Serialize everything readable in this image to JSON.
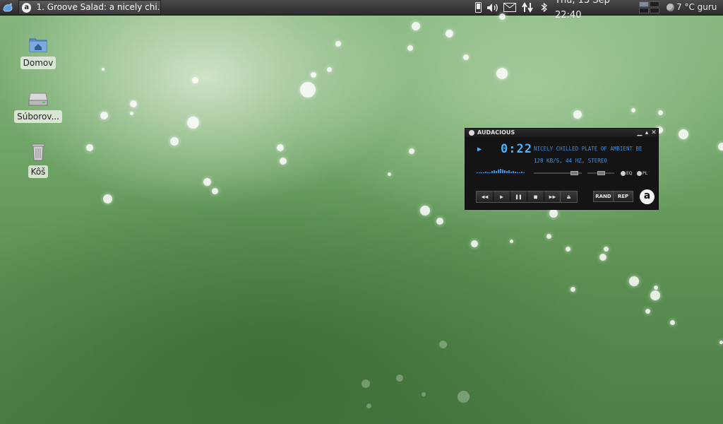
{
  "panel": {
    "task": {
      "label": "1. Groove Salad: a nicely chi..."
    },
    "clock": "Thu, 13 Sep  22:40",
    "weather": "7 °C guru",
    "tray_icons": [
      "phone-icon",
      "volume-icon",
      "mail-icon",
      "network-icon",
      "bluetooth-icon"
    ]
  },
  "desktop": {
    "icons": [
      {
        "label": "Domov"
      },
      {
        "label": "Súborov..."
      },
      {
        "label": "Kôš"
      }
    ]
  },
  "audacious": {
    "title": "AUDACIOUS",
    "time": "0:22",
    "marquee": "NICELY CHILLED PLATE OF AMBIENT BE",
    "info": "128 KB/S, 44 HZ, STEREO",
    "eq_label": "EQ",
    "pl_label": "PL",
    "rand_label": "RAND",
    "rep_label": "REP",
    "logo": "a"
  },
  "colors": {
    "lcd_blue": "#4ab1ff",
    "panel_bg": "#2b2b2b"
  }
}
